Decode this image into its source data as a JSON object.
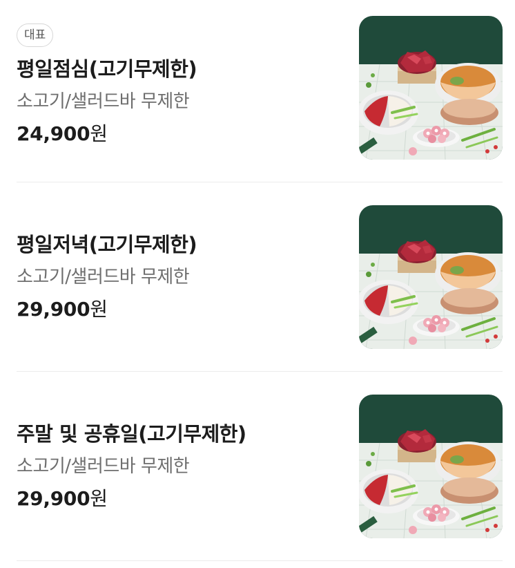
{
  "menu": {
    "items": [
      {
        "badge": "대표",
        "name": "평일점심(고기무제한)",
        "description": "소고기/샐러드바 무제한",
        "price": "24,900",
        "currency": "원",
        "image_icon": "hotpot-photo"
      },
      {
        "name": "평일저녁(고기무제한)",
        "description": "소고기/샐러드바 무제한",
        "price": "29,900",
        "currency": "원",
        "image_icon": "hotpot-photo"
      },
      {
        "name": "주말 및 공휴일(고기무제한)",
        "description": "소고기/샐러드바 무제한",
        "price": "29,900",
        "currency": "원",
        "image_icon": "hotpot-photo"
      }
    ]
  },
  "colors": {
    "background_green": "#1f4a3a",
    "text_primary": "#1c1c1c",
    "text_secondary": "#6e6e6e",
    "divider": "#ececec"
  }
}
